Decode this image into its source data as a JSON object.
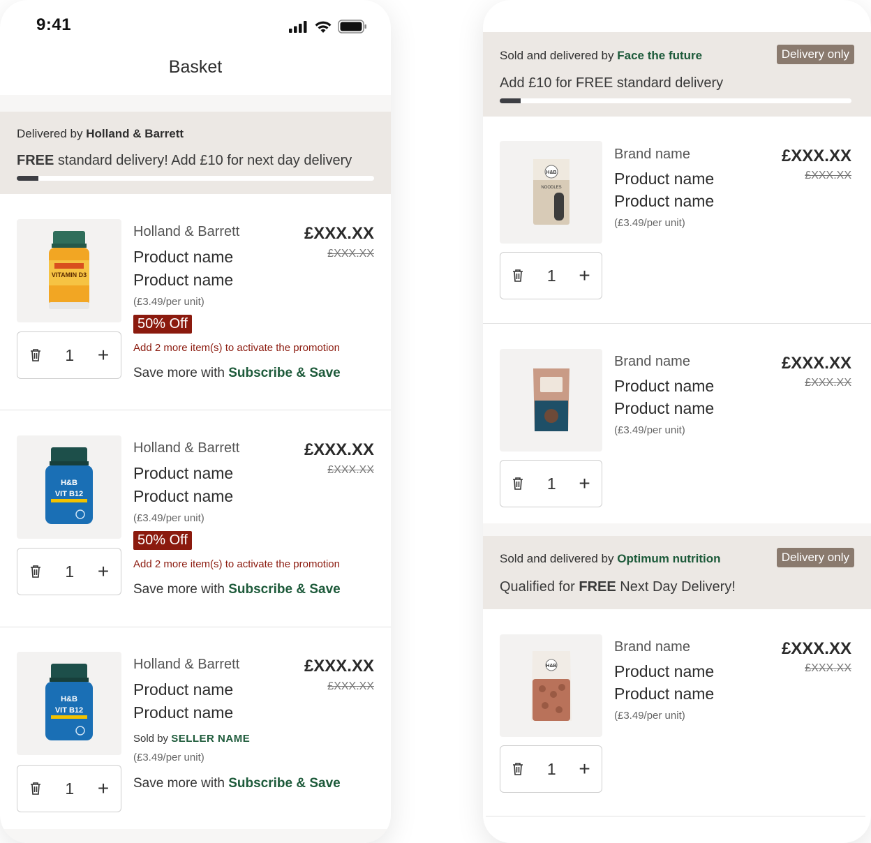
{
  "status_bar": {
    "time": "9:41"
  },
  "page_title": "Basket",
  "hb_banner": {
    "prefix": "Delivered by",
    "seller": "Holland & Barrett",
    "message_bold": "FREE",
    "message_rest": " standard delivery! Add £10 for next day delivery",
    "progress": 0.06
  },
  "left_items": [
    {
      "brand": "Holland & Barrett",
      "name1": "Product name",
      "name2": "Product name",
      "unit": "(£3.49/per unit)",
      "price": "£XXX.XX",
      "was": "£XXX.XX",
      "badge": "50% Off",
      "promo": "Add 2 more item(s) to activate the promotion",
      "subsave_prefix": "Save more with",
      "subsave_link": "Subscribe & Save",
      "qty": "1",
      "image": "vitamin-d3-jar"
    },
    {
      "brand": "Holland & Barrett",
      "name1": "Product name",
      "name2": "Product name",
      "unit": "(£3.49/per unit)",
      "price": "£XXX.XX",
      "was": "£XXX.XX",
      "badge": "50% Off",
      "promo": "Add 2 more item(s) to activate the promotion",
      "subsave_prefix": "Save more with",
      "subsave_link": "Subscribe & Save",
      "qty": "1",
      "image": "vit-b12-jar"
    },
    {
      "brand": "Holland & Barrett",
      "name1": "Product name",
      "name2": "Product name",
      "sold_prefix": "Sold by",
      "sold_name": "SELLER NAME",
      "unit": "(£3.49/per unit)",
      "price": "£XXX.XX",
      "was": "£XXX.XX",
      "subsave_prefix": "Save more with",
      "subsave_link": "Subscribe & Save",
      "qty": "1",
      "image": "vit-b12-jar"
    }
  ],
  "face_banner": {
    "prefix": "Sold and delivered by",
    "seller": "Face the future",
    "pill": "Delivery only",
    "message": "Add £10 for FREE standard delivery",
    "progress": 0.06
  },
  "right_items": [
    {
      "brand": "Brand name",
      "name1": "Product name",
      "name2": "Product name",
      "unit": "(£3.49/per unit)",
      "price": "£XXX.XX",
      "was": "£XXX.XX",
      "qty": "1",
      "image": "noodles-pack"
    },
    {
      "brand": "Brand name",
      "name1": "Product name",
      "name2": "Product name",
      "unit": "(£3.49/per unit)",
      "price": "£XXX.XX",
      "was": "£XXX.XX",
      "qty": "1",
      "image": "snack-pouch"
    },
    {
      "brand": "Brand name",
      "name1": "Product name",
      "name2": "Product name",
      "unit": "(£3.49/per unit)",
      "price": "£XXX.XX",
      "was": "£XXX.XX",
      "qty": "1",
      "image": "almond-bag"
    }
  ],
  "optimum_banner": {
    "prefix": "Sold and delivered by",
    "seller": "Optimum nutrition",
    "pill": "Delivery only",
    "message_prefix": "Qualified for ",
    "message_bold": "FREE",
    "message_rest": " Next Day Delivery!"
  },
  "colors": {
    "banner_bg": "#ece8e4",
    "accent_green": "#1d5a3a",
    "promo_red": "#8b1a0e",
    "pill_bg": "#8a7a6e"
  }
}
